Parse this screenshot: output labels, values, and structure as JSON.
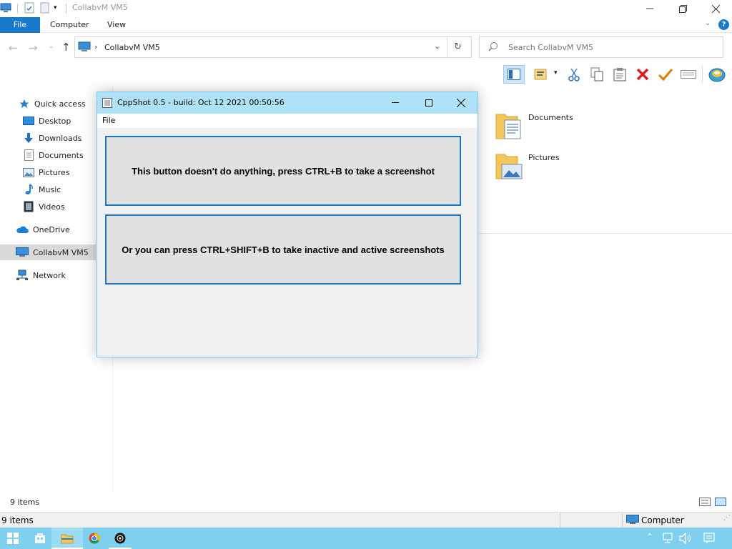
{
  "explorer": {
    "title": "CollabvM VM5",
    "ribbon_tabs": [
      "File",
      "Computer",
      "View"
    ],
    "address": "CollabvM VM5",
    "search_placeholder": "Search CollabvM VM5",
    "nav": {
      "quick_access": "Quick access",
      "items": [
        "Desktop",
        "Downloads",
        "Documents",
        "Pictures",
        "Music",
        "Videos"
      ],
      "onedrive": "OneDrive",
      "this_pc": "CollabvM VM5",
      "network": "Network"
    },
    "content": {
      "folders": [
        "Documents",
        "Pictures"
      ]
    },
    "status_items": "9 items"
  },
  "status2": {
    "items": "9 items",
    "location": "Computer"
  },
  "cppshot": {
    "title": "CppShot 0.5 - build: Oct 12 2021 00:50:56",
    "menu_file": "File",
    "button1": "This button doesn't do anything, press CTRL+B to take a screenshot",
    "button2": "Or you can press CTRL+SHIFT+B to take inactive and active screenshots"
  },
  "colors": {
    "accent": "#1979ca",
    "taskbar": "#7fd0ee",
    "dialog_title": "#aee2f8",
    "button_border": "#1a73c8",
    "delete_red": "#d81e1e",
    "check_orange": "#e07a10"
  }
}
